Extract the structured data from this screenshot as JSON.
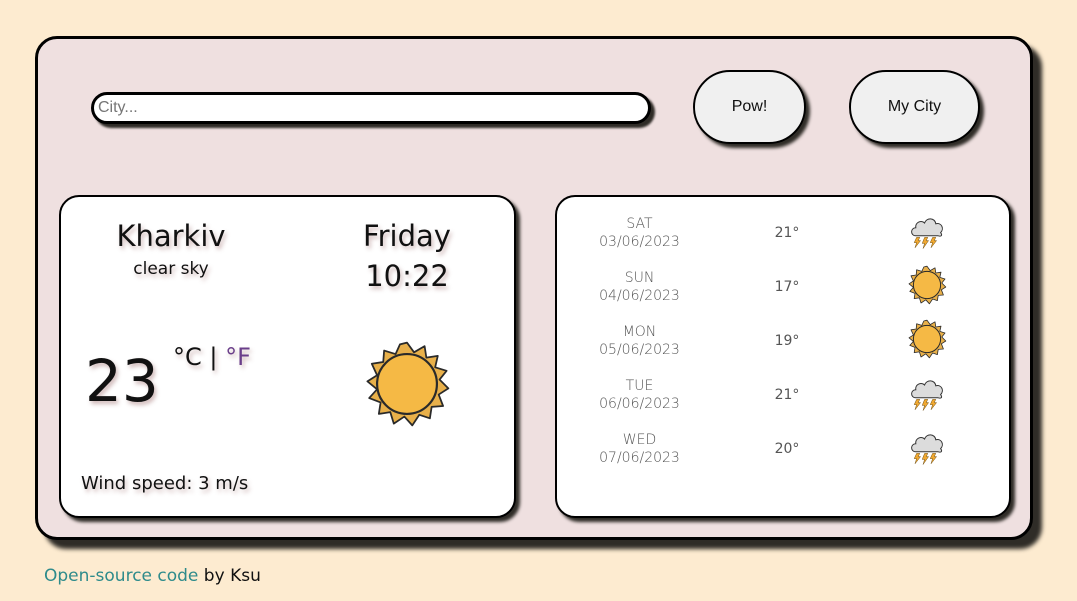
{
  "search": {
    "placeholder": "City...",
    "value": ""
  },
  "buttons": {
    "search_label": "Pow!",
    "my_city_label": "My City"
  },
  "current": {
    "city": "Kharkiv",
    "description": "clear sky",
    "day": "Friday",
    "time": "10:22",
    "temperature": "23",
    "unit_celsius": "°C",
    "unit_separator": "|",
    "unit_fahrenheit": "°F",
    "icon": "sun-icon",
    "wind": "Wind speed: 3 m/s"
  },
  "forecast": [
    {
      "weekday": "SAT",
      "date": "03/06/2023",
      "temp": "21°",
      "icon": "thunderstorm-icon"
    },
    {
      "weekday": "SUN",
      "date": "04/06/2023",
      "temp": "17°",
      "icon": "sun-icon"
    },
    {
      "weekday": "MON",
      "date": "05/06/2023",
      "temp": "19°",
      "icon": "sun-icon"
    },
    {
      "weekday": "TUE",
      "date": "06/06/2023",
      "temp": "21°",
      "icon": "thunderstorm-icon"
    },
    {
      "weekday": "WED",
      "date": "07/06/2023",
      "temp": "20°",
      "icon": "thunderstorm-icon"
    }
  ],
  "footer": {
    "link_text": "Open-source code",
    "suffix": " by Ksu"
  },
  "colors": {
    "page_bg": "#fdebd0",
    "app_bg": "#efe0e0",
    "fahrenheit": "#6a3e8a",
    "link": "#2e8b8b",
    "sun": "#f5b945"
  }
}
